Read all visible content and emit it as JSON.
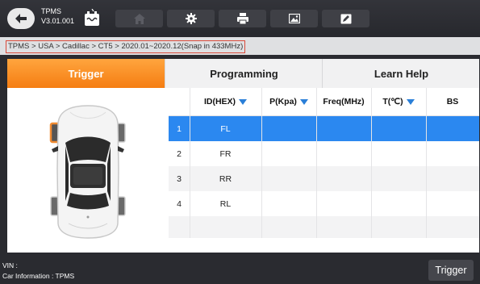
{
  "app": {
    "name": "TPMS",
    "version": "V3.01.001"
  },
  "toolbar": {
    "icons": [
      "back-arrow",
      "battery-voltage",
      "home",
      "gear",
      "print",
      "image",
      "edit"
    ]
  },
  "breadcrumb": "TPMS > USA > Cadillac > CT5 > 2020.01~2020.12(Snap in 433MHz)",
  "tabs": [
    {
      "label": "Trigger",
      "active": true
    },
    {
      "label": "Programming",
      "active": false
    },
    {
      "label": "Learn Help",
      "active": false
    }
  ],
  "table": {
    "columns": [
      "",
      "ID(HEX)",
      "P(Kpa)",
      "Freq(MHz)",
      "T(℃)",
      "BS"
    ],
    "sortable": [
      "ID(HEX)",
      "P(Kpa)",
      "T(℃)"
    ],
    "rows": [
      {
        "no": "1",
        "wheel": "FL",
        "selected": true
      },
      {
        "no": "2",
        "wheel": "FR",
        "selected": false
      },
      {
        "no": "3",
        "wheel": "RR",
        "selected": false
      },
      {
        "no": "4",
        "wheel": "RL",
        "selected": false
      }
    ]
  },
  "footer": {
    "vin_label": "VIN :",
    "car_info": "Car Information : TPMS",
    "trigger_button": "Trigger"
  },
  "colors": {
    "accent": "#f57d12",
    "selected_row": "#2b88f0",
    "highlight_wheel": "#f08a30",
    "breadcrumb_border": "#d94a3a"
  }
}
